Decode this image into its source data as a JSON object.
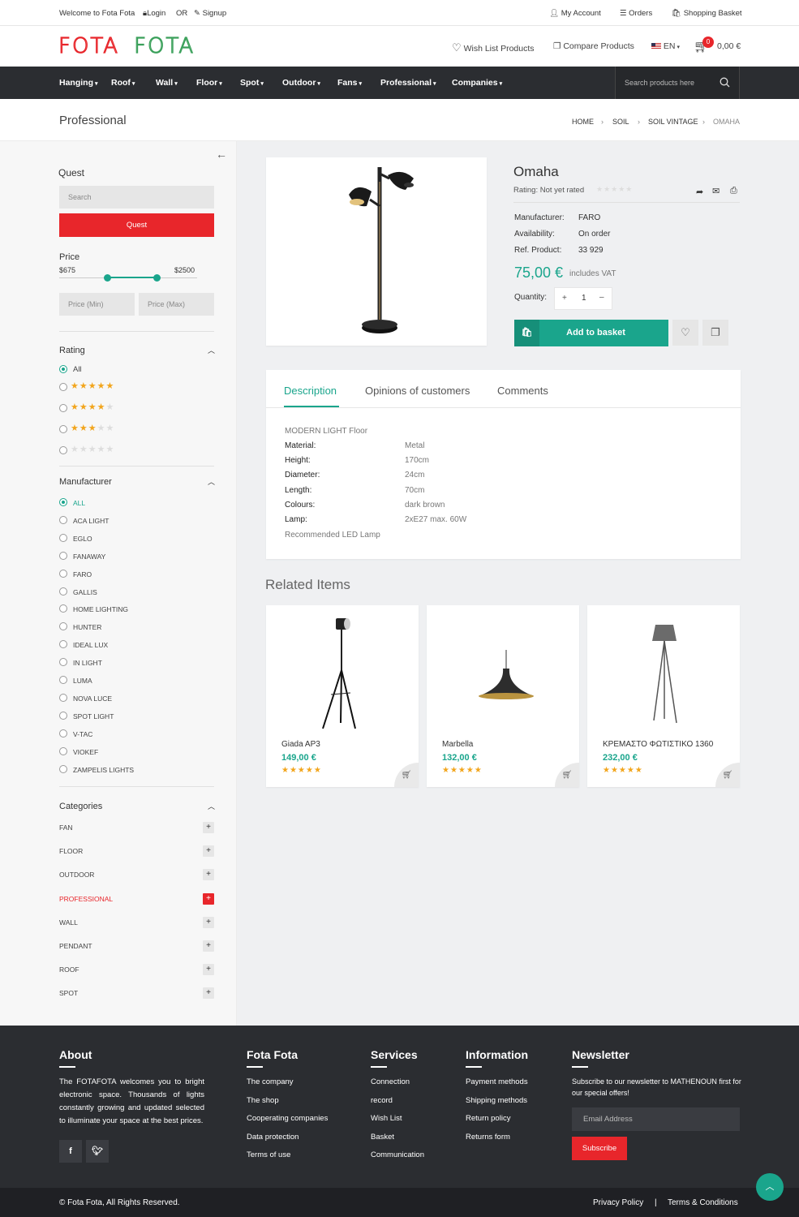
{
  "topbar": {
    "welcome": "Welcome to Fota Fota",
    "login": "Login",
    "or": "OR",
    "signup": "Signup",
    "account": "My Account",
    "orders": "Orders",
    "basket": "Shopping Basket"
  },
  "header": {
    "logo_a": "FOTA",
    "logo_b": "FOTA",
    "wishlist": "Wish List Products",
    "compare": "Compare Products",
    "lang": "EN",
    "cart_count": "0",
    "cart_total": "0,00 €"
  },
  "nav": {
    "items": [
      "Hanging",
      "Roof",
      "Wall",
      "Floor",
      "Spot",
      "Outdoor",
      "Fans",
      "Professional",
      "Companies"
    ],
    "search_placeholder": "Search products here"
  },
  "page": {
    "title": "Professional",
    "breadcrumb": [
      "HOME",
      "SOIL",
      "SOIL VINTAGE",
      "OMAHA"
    ]
  },
  "sidebar": {
    "quest_label": "Quest",
    "search_placeholder": "Search",
    "quest_button": "Quest",
    "price_label": "Price",
    "price_min_value": "$675",
    "price_max_value": "$2500",
    "price_min_placeholder": "Price (Min)",
    "price_max_placeholder": "Price (Max)",
    "rating_label": "Rating",
    "rating_all": "All",
    "rating_options": [
      5,
      4,
      3,
      0
    ],
    "manufacturer_label": "Manufacturer",
    "manufacturers": [
      "ALL",
      "ACA LIGHT",
      "EGLO",
      "FANAWAY",
      "FARO",
      "GALLIS",
      "HOME LIGHTING",
      "HUNTER",
      "IDEAL LUX",
      "IN LIGHT",
      "LUMA",
      "NOVA LUCE",
      "SPOT LIGHT",
      "V-TAC",
      "VIOKEF",
      "ZAMPELIS LIGHTS"
    ],
    "categories_label": "Categories",
    "categories": [
      "FAN",
      "FLOOR",
      "OUTDOOR",
      "PROFESSIONAL",
      "WALL",
      "PENDANT",
      "ROOF",
      "SPOT"
    ],
    "active_category": "PROFESSIONAL"
  },
  "product": {
    "name": "Omaha",
    "rating_text": "Rating: Not yet rated",
    "manufacturer_label": "Manufacturer:",
    "manufacturer": "FARO",
    "availability_label": "Availability:",
    "availability": "On order",
    "ref_label": "Ref. Product:",
    "ref": "33 929",
    "price": "75,00 €",
    "vat": "includes VAT",
    "quantity_label": "Quantity:",
    "quantity": "1",
    "add_to_basket": "Add to basket"
  },
  "tabs": {
    "items": [
      "Description",
      "Opinions of customers",
      "Comments"
    ],
    "active": "Description"
  },
  "description": {
    "intro": "MODERN LIGHT Floor",
    "rows": [
      {
        "label": "Material:",
        "value": "Metal"
      },
      {
        "label": "Height:",
        "value": "170cm"
      },
      {
        "label": "Diameter:",
        "value": "24cm"
      },
      {
        "label": "Length:",
        "value": "70cm"
      },
      {
        "label": "Colours:",
        "value": "dark brown"
      },
      {
        "label": "Lamp:",
        "value": "2xE27 max. 60W"
      }
    ],
    "outro": "Recommended LED Lamp"
  },
  "related": {
    "title": "Related Items",
    "items": [
      {
        "name": "Giada AP3",
        "price": "149,00 €",
        "stars": 5
      },
      {
        "name": "Marbella",
        "price": "132,00 €",
        "stars": 5
      },
      {
        "name": "ΚΡΕΜΑΣΤΟ ΦΩΤΙΣΤΙΚΟ 1360",
        "price": "232,00 €",
        "stars": 5
      }
    ]
  },
  "footer": {
    "about_title": "About",
    "about_text": "The FOTAFOTA welcomes you to bright electronic space. Thousands of lights constantly growing and updated selected to illuminate your space at the best prices.",
    "fota_title": "Fota Fota",
    "fota_links": [
      "The company",
      "The shop",
      "Cooperating companies",
      "Data protection",
      "Terms of use"
    ],
    "services_title": "Services",
    "services_links": [
      "Connection",
      "record",
      "Wish List",
      "Basket",
      "Communication"
    ],
    "info_title": "Information",
    "info_links": [
      "Payment methods",
      "Shipping methods",
      "Return policy",
      "Returns form"
    ],
    "newsletter_title": "Newsletter",
    "newsletter_text": "Subscribe to our newsletter to MATHENOUN first for our special offers!",
    "email_placeholder": "Email Address",
    "subscribe": "Subscribe",
    "copyright": "© Fota Fota, All Rights Reserved.",
    "privacy": "Privacy Policy",
    "separator": "|",
    "terms": "Terms & Conditions"
  },
  "colors": {
    "accent": "#1aa58c",
    "brand_red": "#e8262b",
    "dark": "#2b2d31"
  }
}
